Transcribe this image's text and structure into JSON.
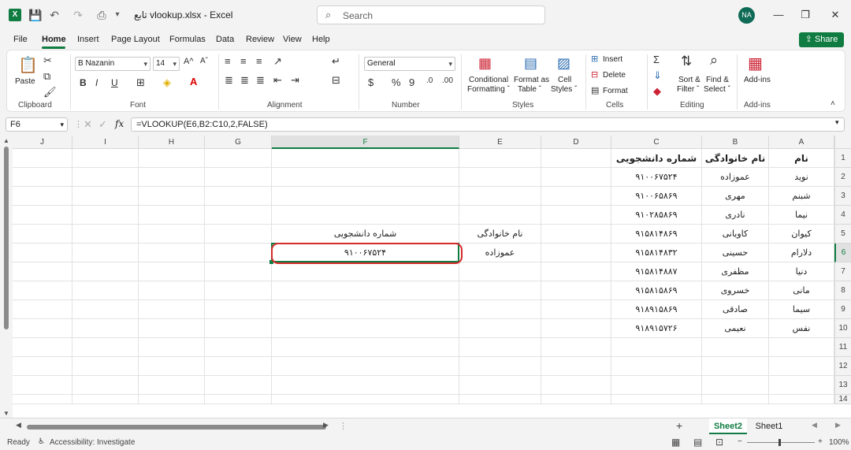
{
  "window": {
    "app_logo": "X",
    "title": "تابع vlookup.xlsx  -  Excel",
    "search_placeholder": "Search",
    "user_initials": "NA",
    "minimize": "—",
    "restore": "❐",
    "close": "✕"
  },
  "quick_access": {
    "save": "💾",
    "undo": "↶",
    "redo": "↷",
    "print": "⎙",
    "more": "▾"
  },
  "menu": {
    "items": [
      "File",
      "Home",
      "Insert",
      "Page Layout",
      "Formulas",
      "Data",
      "Review",
      "View",
      "Help"
    ],
    "share_label": "Share"
  },
  "ribbon": {
    "clipboard": {
      "label": "Clipboard",
      "paste": "Paste"
    },
    "font": {
      "label": "Font",
      "font_name": "B Nazanin",
      "font_size": "14",
      "bold": "B",
      "italic": "I",
      "underline": "U",
      "grow": "A^",
      "shrink": "Aˇ"
    },
    "alignment": {
      "label": "Alignment"
    },
    "number": {
      "label": "Number",
      "format": "General",
      "currency": "$",
      "percent": "%",
      "comma": "9"
    },
    "styles": {
      "label": "Styles",
      "conditional_1": "Conditional",
      "conditional_2": "Formatting ˇ",
      "format_table_1": "Format as",
      "format_table_2": "Table ˇ",
      "cell_styles_1": "Cell",
      "cell_styles_2": "Styles ˇ"
    },
    "cells": {
      "label": "Cells",
      "insert": "Insert",
      "delete": "Delete",
      "format": "Format"
    },
    "editing": {
      "label": "Editing",
      "sort_1": "Sort &",
      "sort_2": "Filter ˇ",
      "find_1": "Find &",
      "find_2": "Select ˇ"
    },
    "addins": {
      "label": "Add-ins",
      "button": "Add-ins"
    }
  },
  "formula_bar": {
    "name_box": "F6",
    "fx": "fx",
    "formula": "=VLOOKUP(E6,B2:C10,2,FALSE)"
  },
  "columns": [
    "J",
    "I",
    "H",
    "G",
    "F",
    "E",
    "D",
    "C",
    "B",
    "A"
  ],
  "rows": [
    "1",
    "2",
    "3",
    "4",
    "5",
    "6",
    "7",
    "8",
    "9",
    "10",
    "11",
    "12",
    "13",
    "14"
  ],
  "table": {
    "headers": {
      "name": "نام",
      "family": "نام خانوادگی",
      "student_id": "شماره دانشجویی"
    },
    "records": [
      {
        "name": "نوید",
        "family": "عموزاده",
        "student_id": "۹۱۰۰۶۷۵۲۴"
      },
      {
        "name": "شبنم",
        "family": "مهری",
        "student_id": "۹۱۰۰۶۵۸۶۹"
      },
      {
        "name": "نیما",
        "family": "نادری",
        "student_id": "۹۱۰۲۸۵۸۶۹"
      },
      {
        "name": "کیوان",
        "family": "کاویانی",
        "student_id": "۹۱۵۸۱۴۸۶۹"
      },
      {
        "name": "دلارام",
        "family": "حسینی",
        "student_id": "۹۱۵۸۱۴۸۳۲"
      },
      {
        "name": "دنیا",
        "family": "مظفری",
        "student_id": "۹۱۵۸۱۴۸۸۷"
      },
      {
        "name": "مانی",
        "family": "خسروی",
        "student_id": "۹۱۵۸۱۵۸۶۹"
      },
      {
        "name": "سیما",
        "family": "صادقی",
        "student_id": "۹۱۸۹۱۵۸۶۹"
      },
      {
        "name": "نفس",
        "family": "نعیمی",
        "student_id": "۹۱۸۹۱۵۷۲۶"
      }
    ]
  },
  "lookup": {
    "label_family": "نام خانوادگی",
    "label_student_id": "شماره دانشجویی",
    "input_family": "عموزاده",
    "result_student_id": "۹۱۰۰۶۷۵۲۴"
  },
  "sheets": {
    "tabs": [
      "Sheet2",
      "Sheet1"
    ],
    "active": "Sheet2",
    "add": "+"
  },
  "status": {
    "ready": "Ready",
    "accessibility": "Accessibility: Investigate",
    "zoom": "100%"
  }
}
